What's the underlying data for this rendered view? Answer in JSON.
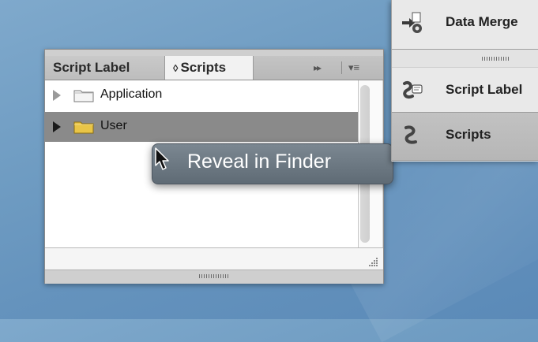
{
  "panel": {
    "tabs": [
      {
        "label": "Script Label"
      },
      {
        "label": "Scripts",
        "prefix": "◊"
      }
    ],
    "toolbar": {
      "fast_forward": "▸▸",
      "menu": "▾≡"
    },
    "tree": [
      {
        "label": "Application"
      },
      {
        "label": "User"
      }
    ]
  },
  "context_menu": {
    "items": [
      {
        "label": "Reveal in Finder"
      }
    ]
  },
  "right_panel": {
    "items": [
      {
        "label": "Data Merge"
      },
      {
        "label": "Script Label"
      },
      {
        "label": "Scripts"
      }
    ]
  },
  "colors": {
    "desktop": "#6f9cc2",
    "panel_bg": "#d6d6d6",
    "selected_row": "#8a8a8a",
    "context_menu": "#6a7680",
    "folder_yellow": "#e9c547",
    "folder_white": "#f2f2f2"
  }
}
